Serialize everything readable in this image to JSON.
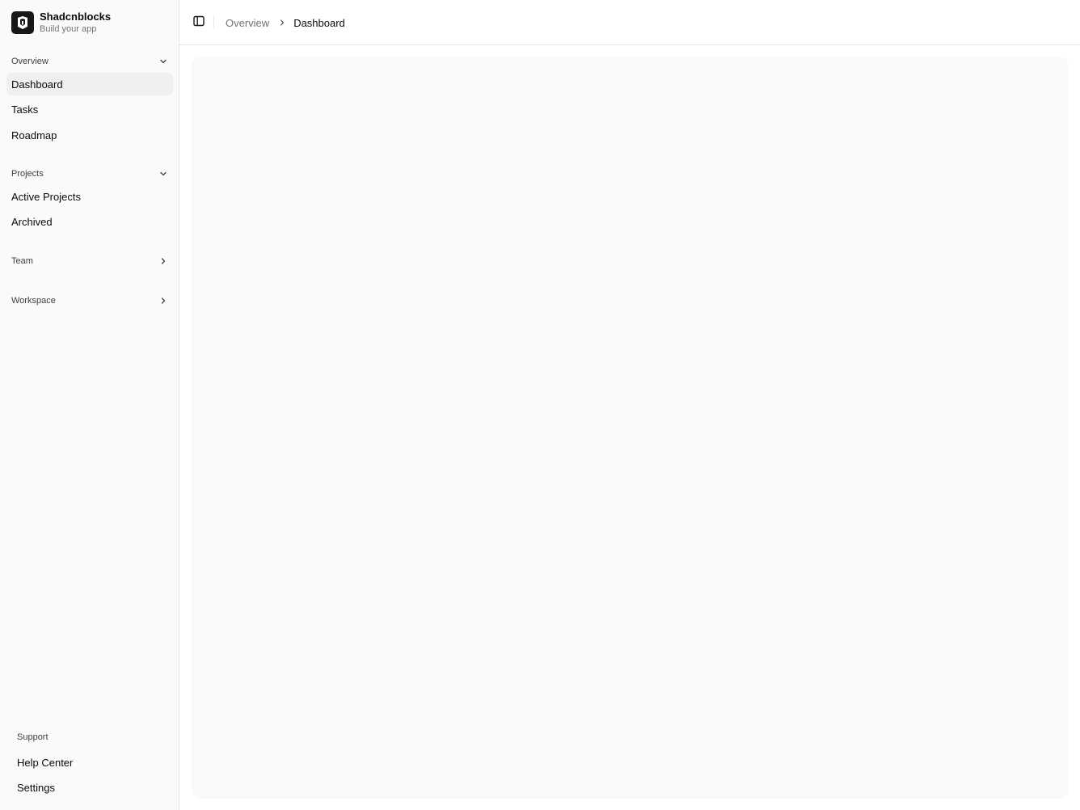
{
  "brand": {
    "name": "Shadcnblocks",
    "tagline": "Build your app",
    "logo_icon": "shadcnblocks-logo-icon"
  },
  "sidebar": {
    "groups": [
      {
        "label": "Overview",
        "expanded": true,
        "chevron": "chevron-down-icon",
        "items": [
          {
            "label": "Dashboard",
            "active": true
          },
          {
            "label": "Tasks",
            "active": false
          },
          {
            "label": "Roadmap",
            "active": false
          }
        ]
      },
      {
        "label": "Projects",
        "expanded": true,
        "chevron": "chevron-down-icon",
        "items": [
          {
            "label": "Active Projects",
            "active": false
          },
          {
            "label": "Archived",
            "active": false
          }
        ]
      },
      {
        "label": "Team",
        "expanded": false,
        "chevron": "chevron-right-icon",
        "items": []
      },
      {
        "label": "Workspace",
        "expanded": false,
        "chevron": "chevron-right-icon",
        "items": []
      }
    ],
    "support": {
      "label": "Support",
      "items": [
        {
          "label": "Help Center"
        },
        {
          "label": "Settings"
        }
      ]
    }
  },
  "header": {
    "toggle_icon": "sidebar-toggle-icon",
    "breadcrumb": {
      "parent": "Overview",
      "separator_icon": "chevron-right-icon",
      "current": "Dashboard"
    }
  },
  "colors": {
    "sidebar_bg": "#fafafa",
    "active_item_bg": "#f0f0f0",
    "content_panel_bg": "#f9f9f9",
    "border": "#e5e5e5",
    "muted_text": "#737373"
  }
}
